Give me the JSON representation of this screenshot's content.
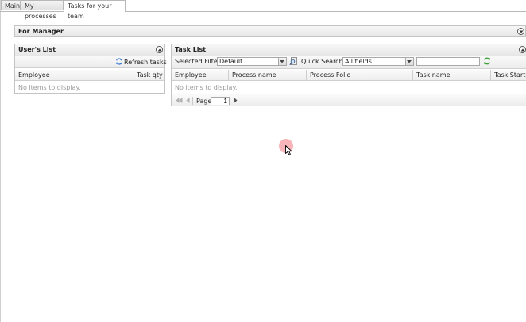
{
  "tabs": [
    {
      "label": "Main",
      "active": false
    },
    {
      "label": "My processes",
      "active": false
    },
    {
      "label": "Tasks for your team",
      "active": true
    }
  ],
  "manager_panel": {
    "title": "For Manager"
  },
  "users_panel": {
    "title": "User's List",
    "refresh_label": "Refresh tasks",
    "columns": [
      "Employee",
      "Task qty"
    ],
    "empty_text": "No items to display."
  },
  "task_panel": {
    "title": "Task List",
    "filter_label": "Selected Filter:",
    "filter_value": "Default",
    "quick_search_label": "Quick Search:",
    "quick_search_field": "All fields",
    "search_value": "",
    "columns": [
      "Employee",
      "Process name",
      "Process Folio",
      "Task name",
      "Task Start D"
    ],
    "empty_text": "No items to display.",
    "pager": {
      "page_label": "Page",
      "page_value": "1"
    }
  },
  "colors": {
    "refresh_icon": "#3a7bd5",
    "search_refresh_icon": "#3aa13a",
    "cursor_highlight": "#f07882"
  }
}
